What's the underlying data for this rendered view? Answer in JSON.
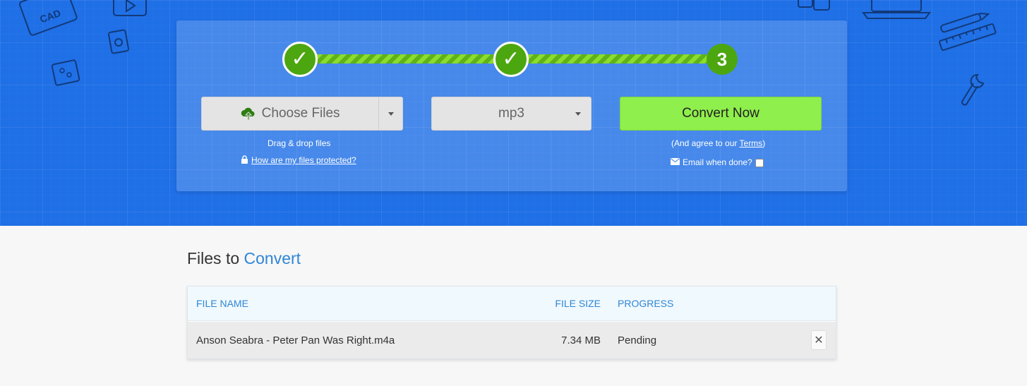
{
  "steps": {
    "step1_icon": "check-icon",
    "step2_icon": "check-icon",
    "step3_number": "3",
    "step_color": "#4ca60f"
  },
  "upload": {
    "choose_label": "Choose Files",
    "drag_drop_text": "Drag & drop files",
    "protected_link": "How are my files protected?"
  },
  "format": {
    "selected": "mp3"
  },
  "convert": {
    "button_label": "Convert Now",
    "agree_prefix": "(And agree to our ",
    "terms_link": "Terms",
    "agree_suffix": ")",
    "email_label": "Email when done?",
    "email_checked": false
  },
  "files": {
    "title_prefix": "Files to ",
    "title_accent": "Convert",
    "columns": [
      "FILE NAME",
      "FILE SIZE",
      "PROGRESS"
    ],
    "rows": [
      {
        "name": "Anson Seabra - Peter Pan Was Right.m4a",
        "size": "7.34 MB",
        "progress": "Pending"
      }
    ]
  },
  "colors": {
    "hero_bg": "#1f6fe6",
    "convert_green": "#8fef4c",
    "accent_blue": "#2f86d6"
  }
}
